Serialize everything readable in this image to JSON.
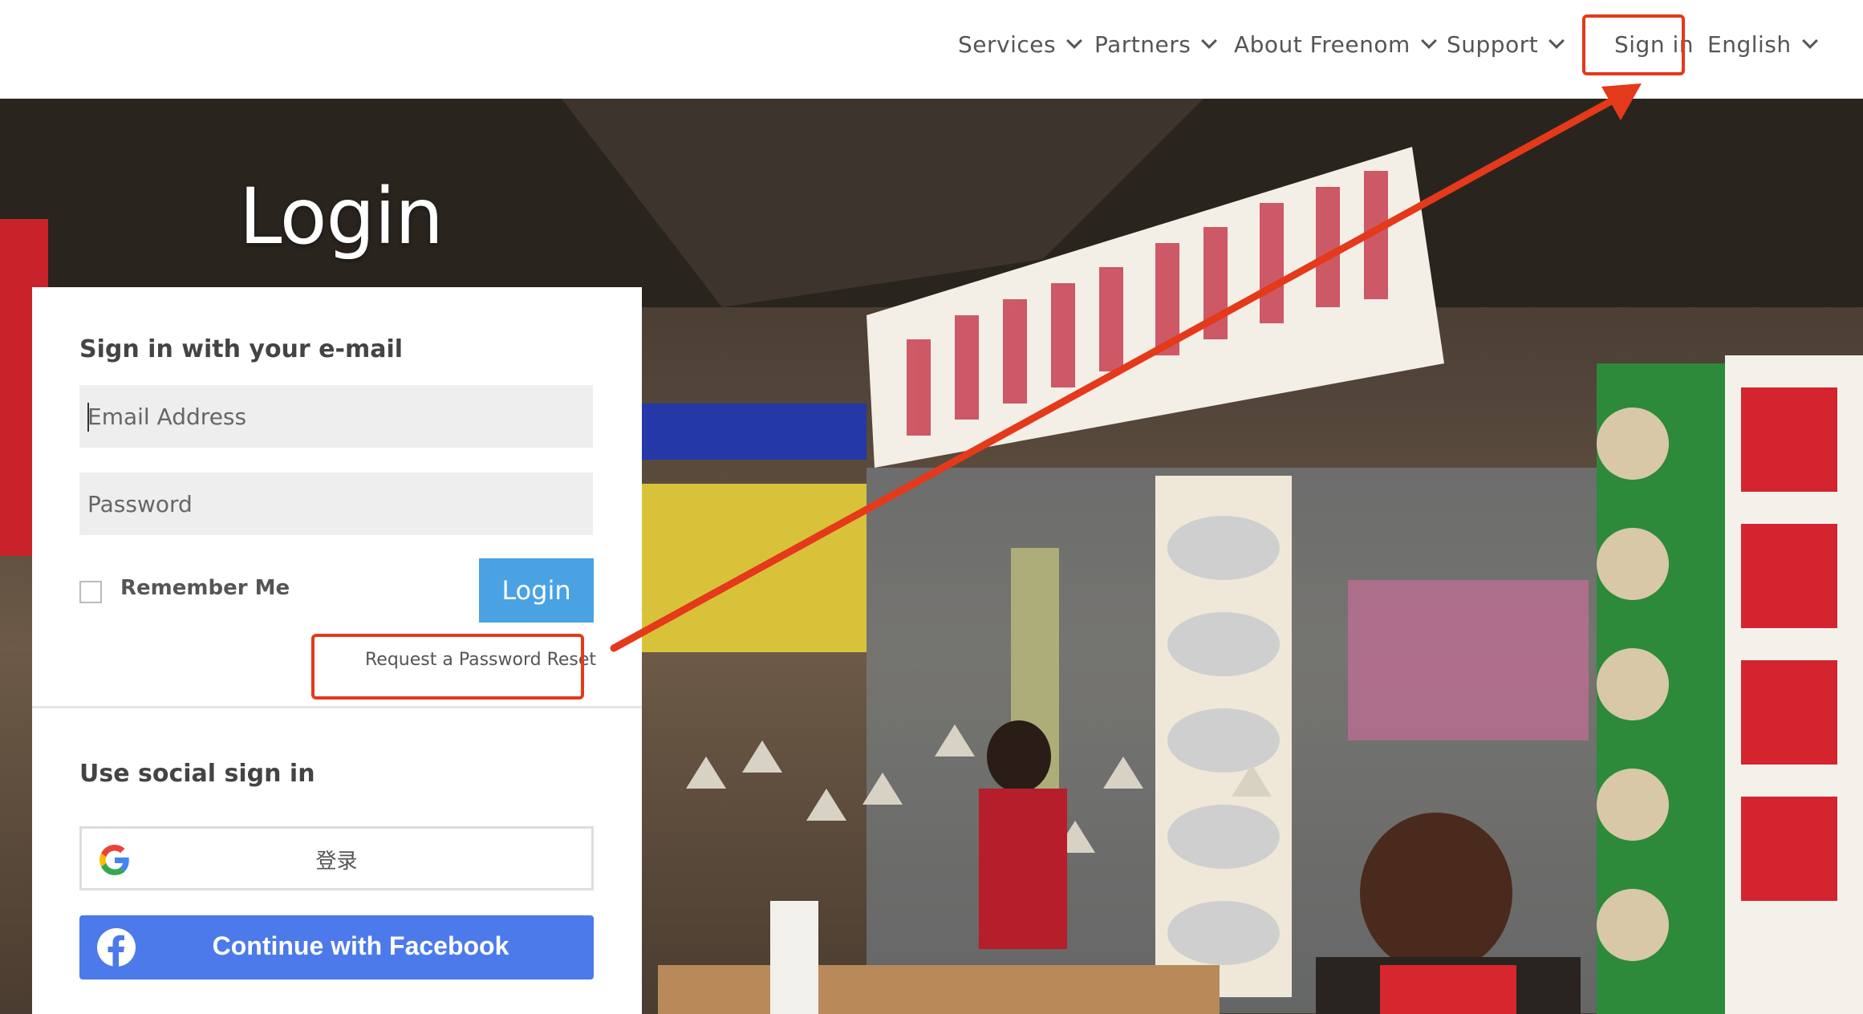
{
  "nav": {
    "items": [
      {
        "label": "Services"
      },
      {
        "label": "Partners"
      },
      {
        "label": "About Freenom"
      },
      {
        "label": "Support"
      }
    ],
    "sign_in": "Sign in",
    "language": "English"
  },
  "page": {
    "title": "Login"
  },
  "login_form": {
    "heading": "Sign in with your e-mail",
    "email_placeholder": "Email Address",
    "password_placeholder": "Password",
    "remember_label": "Remember Me",
    "login_button": "Login",
    "reset_link": "Request a Password Reset"
  },
  "social": {
    "heading": "Use social sign in",
    "google_label": "登录",
    "facebook_label": "Continue with Facebook"
  },
  "colors": {
    "annotation": "#e4391b",
    "login_button": "#4aa2e3",
    "facebook": "#4c7aeb"
  },
  "icons": [
    "chevron-down-icon",
    "google-icon",
    "facebook-icon"
  ]
}
